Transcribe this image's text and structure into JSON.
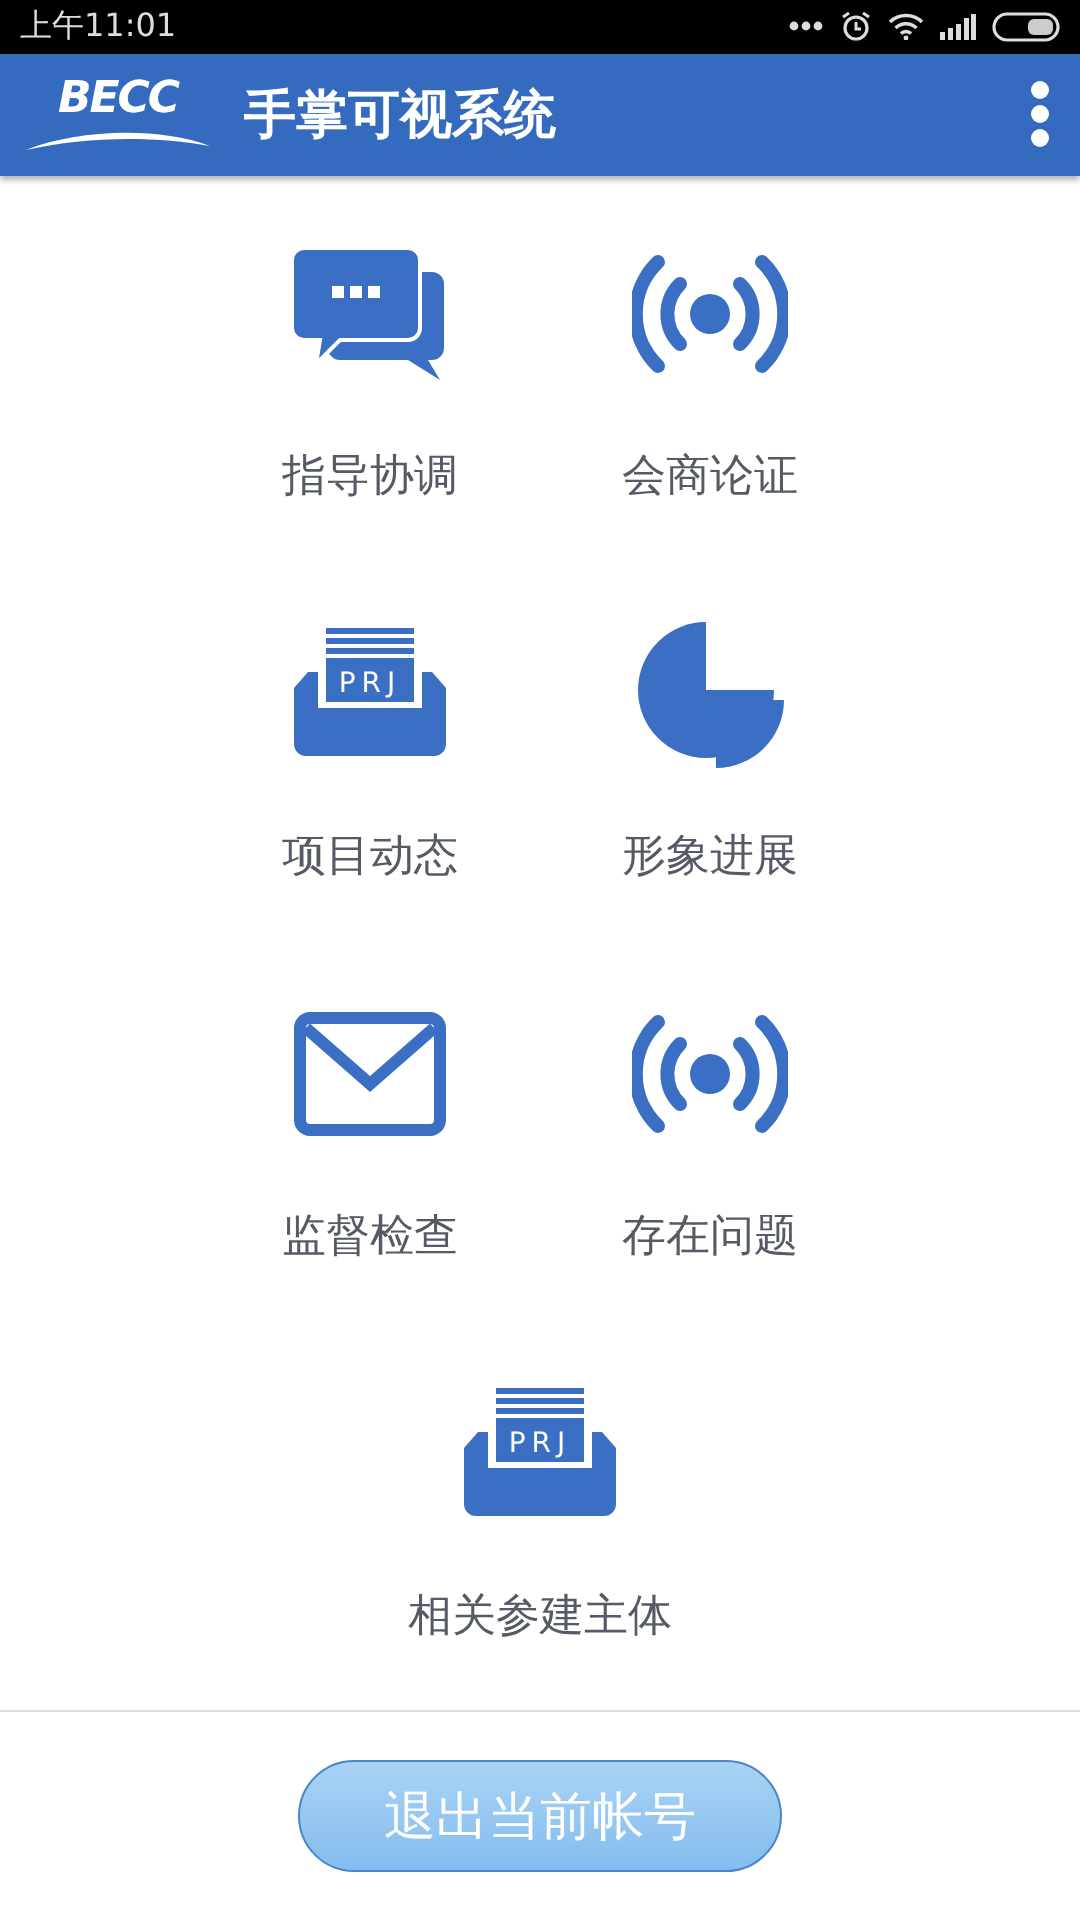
{
  "status_bar": {
    "time": "上午11:01"
  },
  "app_bar": {
    "logo": "BECC",
    "title": "手掌可视系统"
  },
  "menu": [
    {
      "kind": "chat",
      "label": "指导协调"
    },
    {
      "kind": "broadcast",
      "label": "会商论证"
    },
    {
      "kind": "tray",
      "label": "项目动态",
      "icon_text": "PRJ"
    },
    {
      "kind": "pie",
      "label": "形象进展"
    },
    {
      "kind": "mail",
      "label": "监督检查"
    },
    {
      "kind": "broadcast",
      "label": "存在问题"
    },
    {
      "kind": "tray",
      "label": "相关参建主体",
      "icon_text": "PRJ"
    }
  ],
  "footer": {
    "button": "退出当前帐号"
  }
}
